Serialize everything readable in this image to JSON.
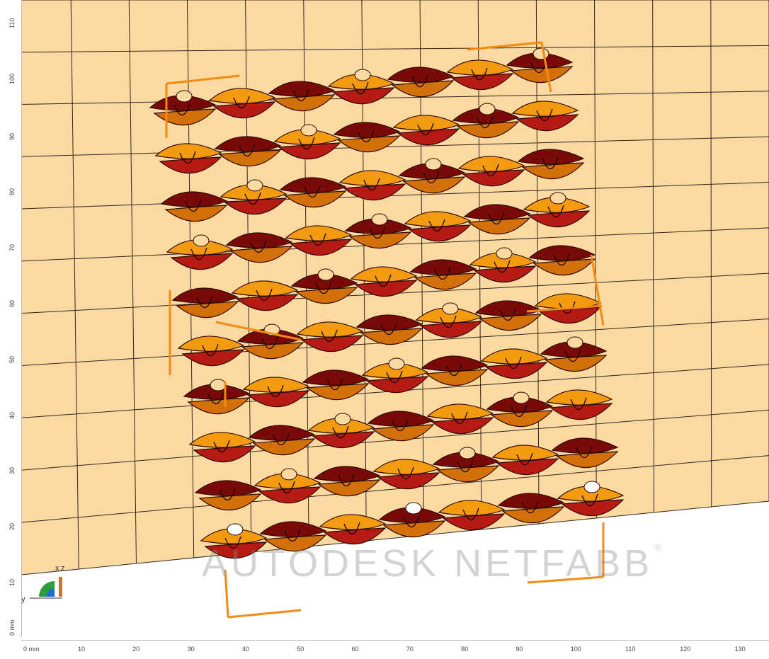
{
  "viewport": {
    "colors": {
      "plate": "#fcd9a0",
      "grid": "#2f2620",
      "lattice_light": "#f39a10",
      "lattice_mid": "#d4700a",
      "lattice_dark": "#7a0a08",
      "lattice_red": "#b51a14",
      "bbox": "#f28a14"
    }
  },
  "ruler_vertical": {
    "unit": "0 mm",
    "labels": [
      "10",
      "20",
      "30",
      "40",
      "50",
      "60",
      "70",
      "80",
      "90",
      "100",
      "110"
    ]
  },
  "ruler_horizontal": {
    "unit": "0 mm",
    "labels": [
      "10",
      "20",
      "30",
      "40",
      "50",
      "60",
      "70",
      "80",
      "90",
      "100",
      "110",
      "120",
      "130"
    ]
  },
  "watermark": {
    "text": "AUTODESK NETFABB",
    "mark": "®"
  },
  "axis_widget": {
    "x": "x",
    "y": "y",
    "z": "z"
  }
}
